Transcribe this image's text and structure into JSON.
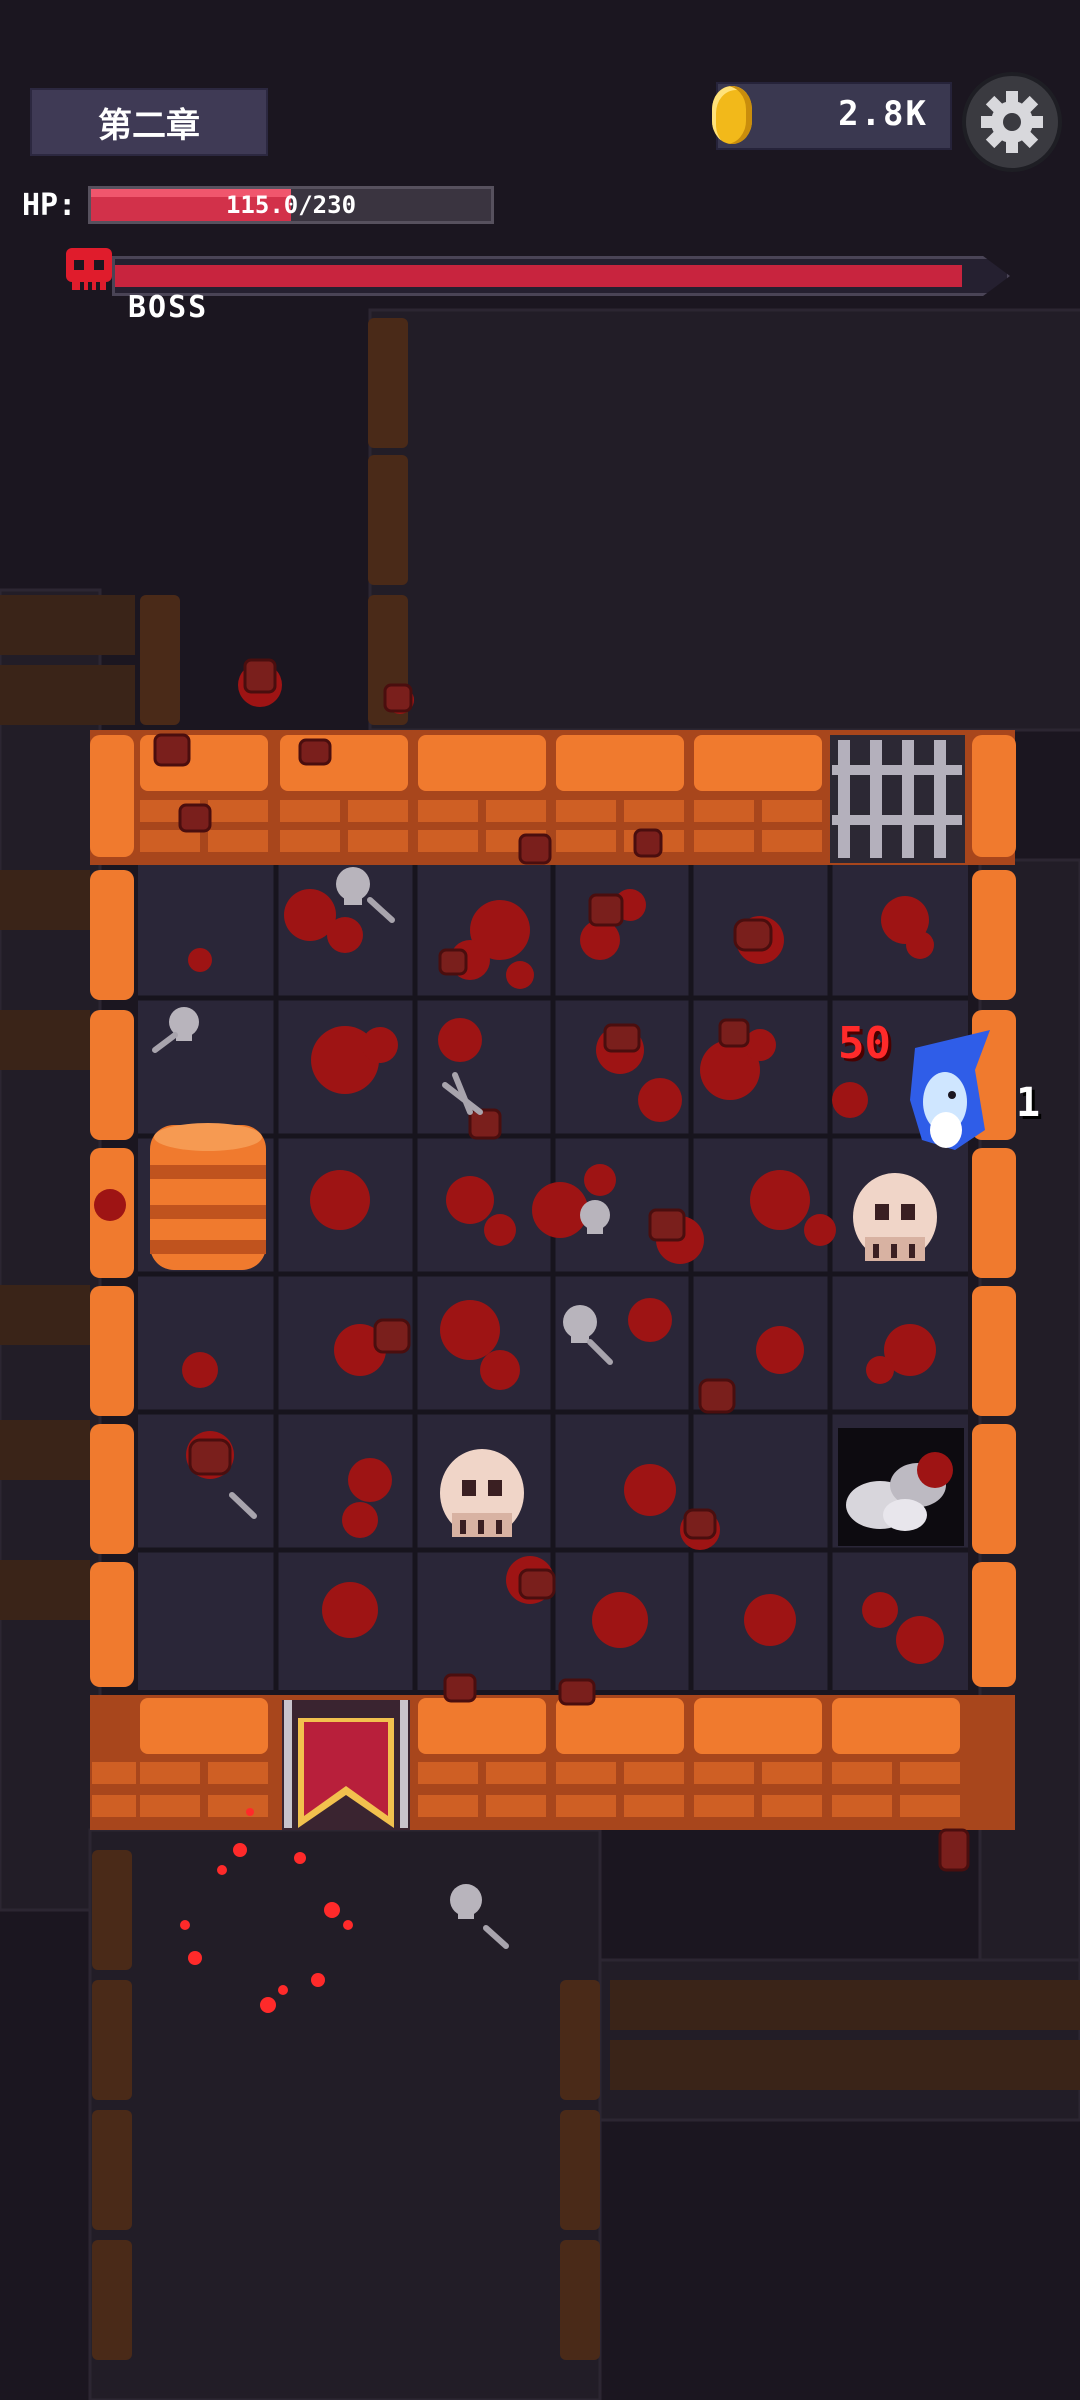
{
  "header": {
    "chapter_label": "第二章",
    "coins": "2.8K"
  },
  "player": {
    "hp_label": "HP:",
    "hp_text": "115.0/230",
    "hp_fraction": 0.5
  },
  "boss": {
    "label": "BOSS",
    "hp_fraction": 0.95
  },
  "combat_text": {
    "damage_red": "50",
    "damage_white": "1"
  },
  "colors": {
    "floor": "#2a2638",
    "wall_orange": "#f07a2e",
    "blood": "#9e1414",
    "hp_red": "#d2314a"
  },
  "icons": [
    "coin-icon",
    "gear-icon",
    "boss-skull-icon",
    "skull-icon",
    "banner-icon",
    "ghost-player-icon"
  ]
}
